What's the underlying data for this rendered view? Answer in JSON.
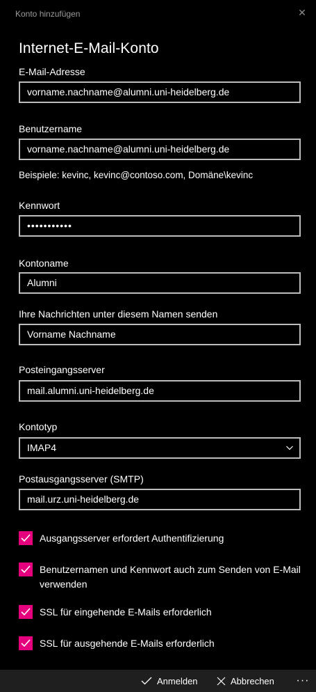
{
  "window": {
    "title": "Konto hinzufügen",
    "close_glyph": "✕"
  },
  "heading": "Internet-E-Mail-Konto",
  "fields": {
    "email": {
      "label": "E-Mail-Adresse",
      "value": "vorname.nachname@alumni.uni-heidelberg.de"
    },
    "username": {
      "label": "Benutzername",
      "value": "vorname.nachname@alumni.uni-heidelberg.de",
      "hint": "Beispiele: kevinc, kevinc@contoso.com, Domäne\\kevinc"
    },
    "password": {
      "label": "Kennwort",
      "value": "•••••••••••"
    },
    "account_name": {
      "label": "Kontoname",
      "value": "Alumni"
    },
    "sender_name": {
      "label": "Ihre Nachrichten unter diesem Namen senden",
      "value": "Vorname Nachname"
    },
    "incoming_server": {
      "label": "Posteingangsserver",
      "value": "mail.alumni.uni-heidelberg.de"
    },
    "account_type": {
      "label": "Kontotyp",
      "value": "IMAP4"
    },
    "outgoing_server": {
      "label": "Postausgangsserver (SMTP)",
      "value": "mail.urz.uni-heidelberg.de"
    }
  },
  "checkboxes": [
    {
      "label": "Ausgangsserver erfordert Authentifizierung",
      "checked": true
    },
    {
      "label": "Benutzernamen und Kennwort auch zum Senden von E-Mail verwenden",
      "checked": true
    },
    {
      "label": "SSL für eingehende E-Mails erforderlich",
      "checked": true
    },
    {
      "label": "SSL für ausgehende E-Mails erforderlich",
      "checked": true
    }
  ],
  "actions": {
    "signin_label": "Anmelden",
    "cancel_label": "Abbrechen",
    "more_glyph": "···"
  },
  "colors": {
    "accent": "#e5007e",
    "background": "#000000",
    "bar": "#1f1f1f"
  }
}
